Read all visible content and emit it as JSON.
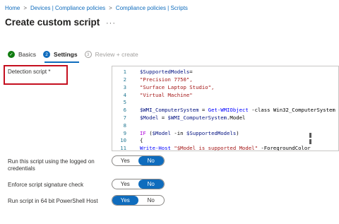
{
  "breadcrumb": {
    "items": [
      "Home",
      "Devices | Compliance policies",
      "Compliance policies | Scripts"
    ],
    "separator": ">"
  },
  "page": {
    "title": "Create custom script",
    "more_glyph": "···"
  },
  "steps": [
    {
      "number": "1",
      "label": "Basics",
      "status": "done",
      "glyph": "✓"
    },
    {
      "number": "2",
      "label": "Settings",
      "status": "active"
    },
    {
      "number": "3",
      "label": "Review + create",
      "status": "pending"
    }
  ],
  "detection_script": {
    "label": "Detection script *"
  },
  "code_lines": [
    {
      "n": "1",
      "tokens": [
        {
          "t": "$SupportedModels",
          "c": "var"
        },
        {
          "t": "=",
          "c": "op"
        }
      ]
    },
    {
      "n": "2",
      "tokens": [
        {
          "t": "\"Precision 7750\",",
          "c": "str"
        }
      ]
    },
    {
      "n": "3",
      "tokens": [
        {
          "t": "\"Surface Laptop Studio\",",
          "c": "str"
        }
      ]
    },
    {
      "n": "4",
      "tokens": [
        {
          "t": "\"Virtual Machine\"",
          "c": "str"
        }
      ]
    },
    {
      "n": "5",
      "tokens": []
    },
    {
      "n": "6",
      "tokens": [
        {
          "t": "$WMI_ComputerSystem",
          "c": "var"
        },
        {
          "t": " = ",
          "c": "op"
        },
        {
          "t": "Get-WMIObject",
          "c": "cmd"
        },
        {
          "t": " -class ",
          "c": "param"
        },
        {
          "t": "Win32_ComputerSystem",
          "c": "param"
        }
      ]
    },
    {
      "n": "7",
      "tokens": [
        {
          "t": "$Model",
          "c": "var"
        },
        {
          "t": " = ",
          "c": "op"
        },
        {
          "t": "$WMI_ComputerSystem",
          "c": "var"
        },
        {
          "t": ".Model",
          "c": "punc"
        }
      ]
    },
    {
      "n": "8",
      "tokens": []
    },
    {
      "n": "9",
      "tokens": [
        {
          "t": "IF",
          "c": "kw"
        },
        {
          "t": " (",
          "c": "punc"
        },
        {
          "t": "$Model",
          "c": "var"
        },
        {
          "t": " -in ",
          "c": "op"
        },
        {
          "t": "$SupportedModels",
          "c": "var"
        },
        {
          "t": ")",
          "c": "punc"
        }
      ]
    },
    {
      "n": "10",
      "tokens": [
        {
          "t": "{",
          "c": "punc"
        }
      ]
    },
    {
      "n": "11",
      "tokens": [
        {
          "t": "Write-Host",
          "c": "cmd"
        },
        {
          "t": " ",
          "c": "punc"
        },
        {
          "t": "\"$Model is supported Model\"",
          "c": "str"
        },
        {
          "t": " -ForegroundColor",
          "c": "param"
        }
      ]
    }
  ],
  "settings": [
    {
      "label": "Run this script using the logged on credentials",
      "yes": "Yes",
      "no": "No",
      "value": "No"
    },
    {
      "label": "Enforce script signature check",
      "yes": "Yes",
      "no": "No",
      "value": "No"
    },
    {
      "label": "Run script in 64 bit PowerShell Host",
      "yes": "Yes",
      "no": "No",
      "value": "Yes"
    }
  ],
  "colors": {
    "accent": "#0f6cbd",
    "success": "#107c10",
    "highlight": "#c50f1f"
  }
}
